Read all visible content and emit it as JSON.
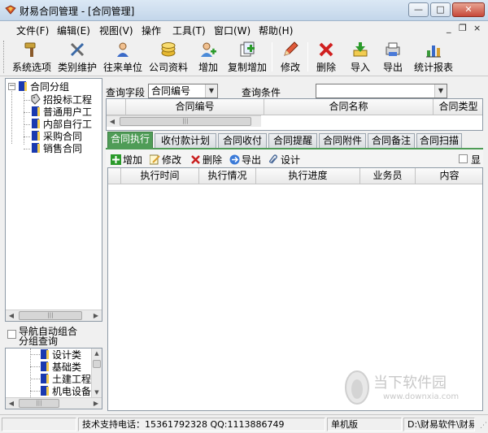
{
  "window": {
    "title": "财易合同管理 - [合同管理]",
    "minimize": "—",
    "maximize": "□",
    "close": "✕"
  },
  "menu": {
    "items": [
      "文件(F)",
      "编辑(E)",
      "视图(V)",
      "操作",
      "工具(T)",
      "窗口(W)",
      "帮助(H)"
    ],
    "mdi_min": "_",
    "mdi_restore": "❐",
    "mdi_close": "×"
  },
  "toolbar": {
    "buttons": [
      "系统选项",
      "类别维护",
      "往来单位",
      "公司资料",
      "增加",
      "复制增加",
      "修改",
      "删除",
      "导入",
      "导出",
      "统计报表"
    ]
  },
  "tree": {
    "root": "合同分组",
    "children": [
      "招投标工程",
      "普通用户工",
      "内部自行工",
      "采购合同",
      "销售合同"
    ]
  },
  "nav_check": {
    "label_line1": "导航自动组合",
    "label_line2": "分组查询"
  },
  "tree2": {
    "items": [
      "设计类",
      "基础类",
      "土建工程",
      "机电设备"
    ]
  },
  "query": {
    "field_label": "查询字段",
    "field_value": "合同编号",
    "cond_label": "查询条件",
    "cond_value": ""
  },
  "grid1": {
    "columns": [
      "合同编号",
      "合同名称",
      "合同类型"
    ]
  },
  "tabs": [
    "合同执行",
    "收付款计划",
    "合同收付",
    "合同提醒",
    "合同附件",
    "合同备注",
    "合同扫描"
  ],
  "subbar": {
    "buttons": [
      "增加",
      "修改",
      "删除",
      "导出",
      "设计"
    ],
    "check_label": "显"
  },
  "grid2": {
    "columns": [
      "执行时间",
      "执行情况",
      "执行进度",
      "业务员",
      "内容"
    ]
  },
  "status": {
    "empty": "",
    "phone": "技术支持电话：15361792328 QQ:1113886749",
    "edition": "单机版",
    "path": "D:\\财易软件\\财易"
  },
  "watermark": {
    "name": "当下软件园",
    "url": "www.downxia.com"
  },
  "colors": {
    "accent_green": "#4f9c57",
    "close_red": "#c7483a"
  }
}
